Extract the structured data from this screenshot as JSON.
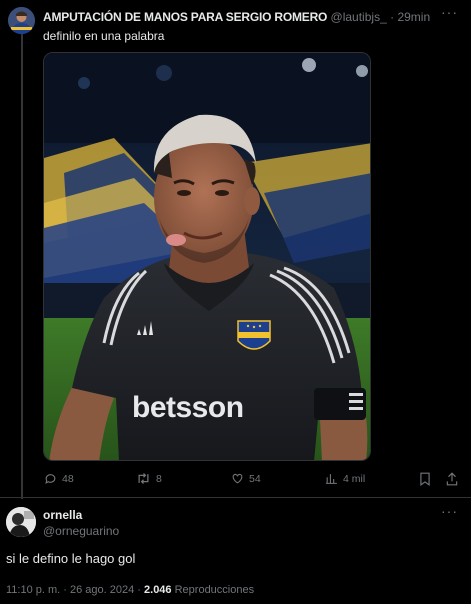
{
  "tweet": {
    "author_name": "AMPUTACIÓN DE MANOS PARA SERGIO ROMERO",
    "handle": "@lautibjs_",
    "separator": "·",
    "time": "29min",
    "text": "definilo en una palabra",
    "media": {
      "jersey_text": "betsson"
    },
    "actions": {
      "replies": "48",
      "retweets": "8",
      "likes": "54",
      "views": "4 mil"
    }
  },
  "reply": {
    "author_name": "ornella",
    "handle": "@orneguarino",
    "text": "si le defino le hago gol",
    "timestamp": "11:10 p. m. · 26 ago. 2024 ·",
    "views_count": "2.046",
    "views_label": "Reproducciones"
  },
  "icons": {
    "reply": "speech-bubble-icon",
    "retweet": "retweet-icon",
    "like": "heart-icon",
    "views": "bar-chart-icon",
    "bookmark": "bookmark-icon",
    "share": "share-icon",
    "more": "more-icon"
  },
  "colors": {
    "background": "#000000",
    "text": "#e7e9ea",
    "muted": "#71767b",
    "divider": "#2f3336",
    "boca_blue": "#1c3f8f",
    "boca_gold": "#f2c12e"
  }
}
